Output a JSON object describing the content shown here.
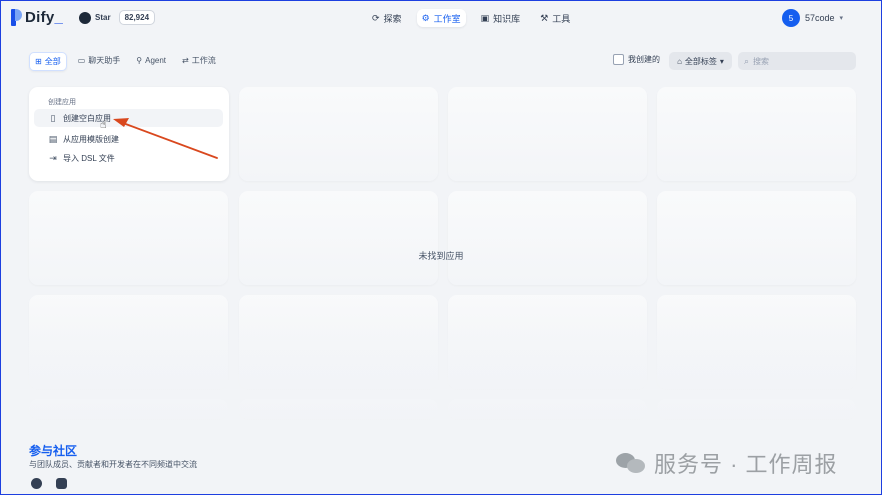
{
  "header": {
    "logo_text": "Dify",
    "github": {
      "star_label": "Star",
      "star_count": "82,924"
    },
    "nav": [
      {
        "label": "探索",
        "icon": "compass-icon"
      },
      {
        "label": "工作室",
        "icon": "robot-icon",
        "active": true
      },
      {
        "label": "知识库",
        "icon": "book-icon"
      },
      {
        "label": "工具",
        "icon": "hammer-icon"
      }
    ],
    "account": {
      "avatar_initial": "5",
      "name": "57code"
    }
  },
  "filters": {
    "tabs": [
      {
        "label": "全部",
        "active": true
      },
      {
        "label": "聊天助手"
      },
      {
        "label": "Agent"
      },
      {
        "label": "工作流"
      }
    ],
    "mine_label": "我创建的",
    "tag_label": "全部标签",
    "search_placeholder": "搜索"
  },
  "create_card": {
    "title": "创建应用",
    "items": [
      {
        "label": "创建空白应用",
        "hovered": true
      },
      {
        "label": "从应用模版创建"
      },
      {
        "label": "导入 DSL 文件"
      }
    ]
  },
  "empty_state": "未找到应用",
  "footer": {
    "title": "参与社区",
    "subtitle": "与团队成员、贡献者和开发者在不同频道中交流"
  },
  "watermark": "服务号 · 工作周报",
  "colors": {
    "accent": "#155eef",
    "arrow": "#d9481e",
    "frame": "#1d3fe0"
  }
}
